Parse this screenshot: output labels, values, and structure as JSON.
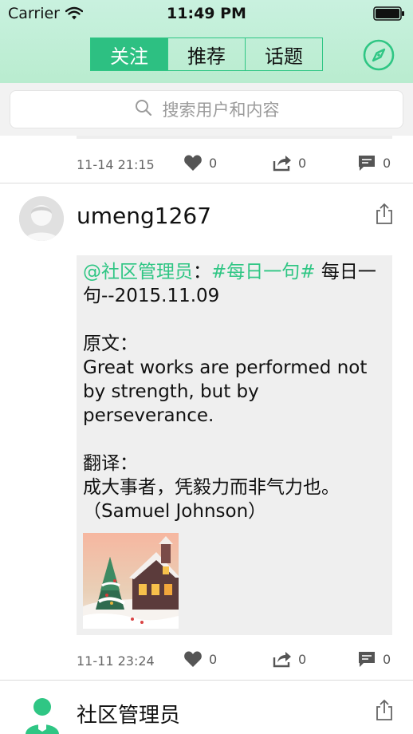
{
  "status_bar": {
    "carrier": "Carrier",
    "time": "11:49 PM"
  },
  "nav": {
    "tabs": [
      {
        "label": "关注",
        "active": true
      },
      {
        "label": "推荐",
        "active": false
      },
      {
        "label": "话题",
        "active": false
      }
    ],
    "accent_color": "#2fc684"
  },
  "search": {
    "placeholder": "搜索用户和内容"
  },
  "feed": {
    "previous_post_actions": {
      "time": "11-14 21:15",
      "likes": "0",
      "forwards": "0",
      "comments": "0"
    },
    "post": {
      "username": "umeng1267",
      "mention": "@社区管理员",
      "separator": "：",
      "topic": "#每日一句#",
      "title_text": " 每日一句--2015.11.09",
      "original_label": "原文：",
      "original_text": "Great works are performed not by strength, but by perseverance.",
      "translation_label": "翻译：",
      "translation_text": "成大事者，凭毅力而非气力也。（Samuel Johnson）",
      "image": "winter-village-painting",
      "time": "11-11 23:24",
      "likes": "0",
      "forwards": "0",
      "comments": "0"
    },
    "next_post": {
      "username": "社区管理员"
    }
  },
  "icons": {
    "wifi": "wifi-icon",
    "battery": "battery-icon",
    "compass": "compass-icon",
    "search": "search-icon",
    "like": "heart-icon",
    "forward": "forward-icon",
    "comment": "comment-icon",
    "share": "share-icon",
    "avatar": "default-avatar"
  }
}
